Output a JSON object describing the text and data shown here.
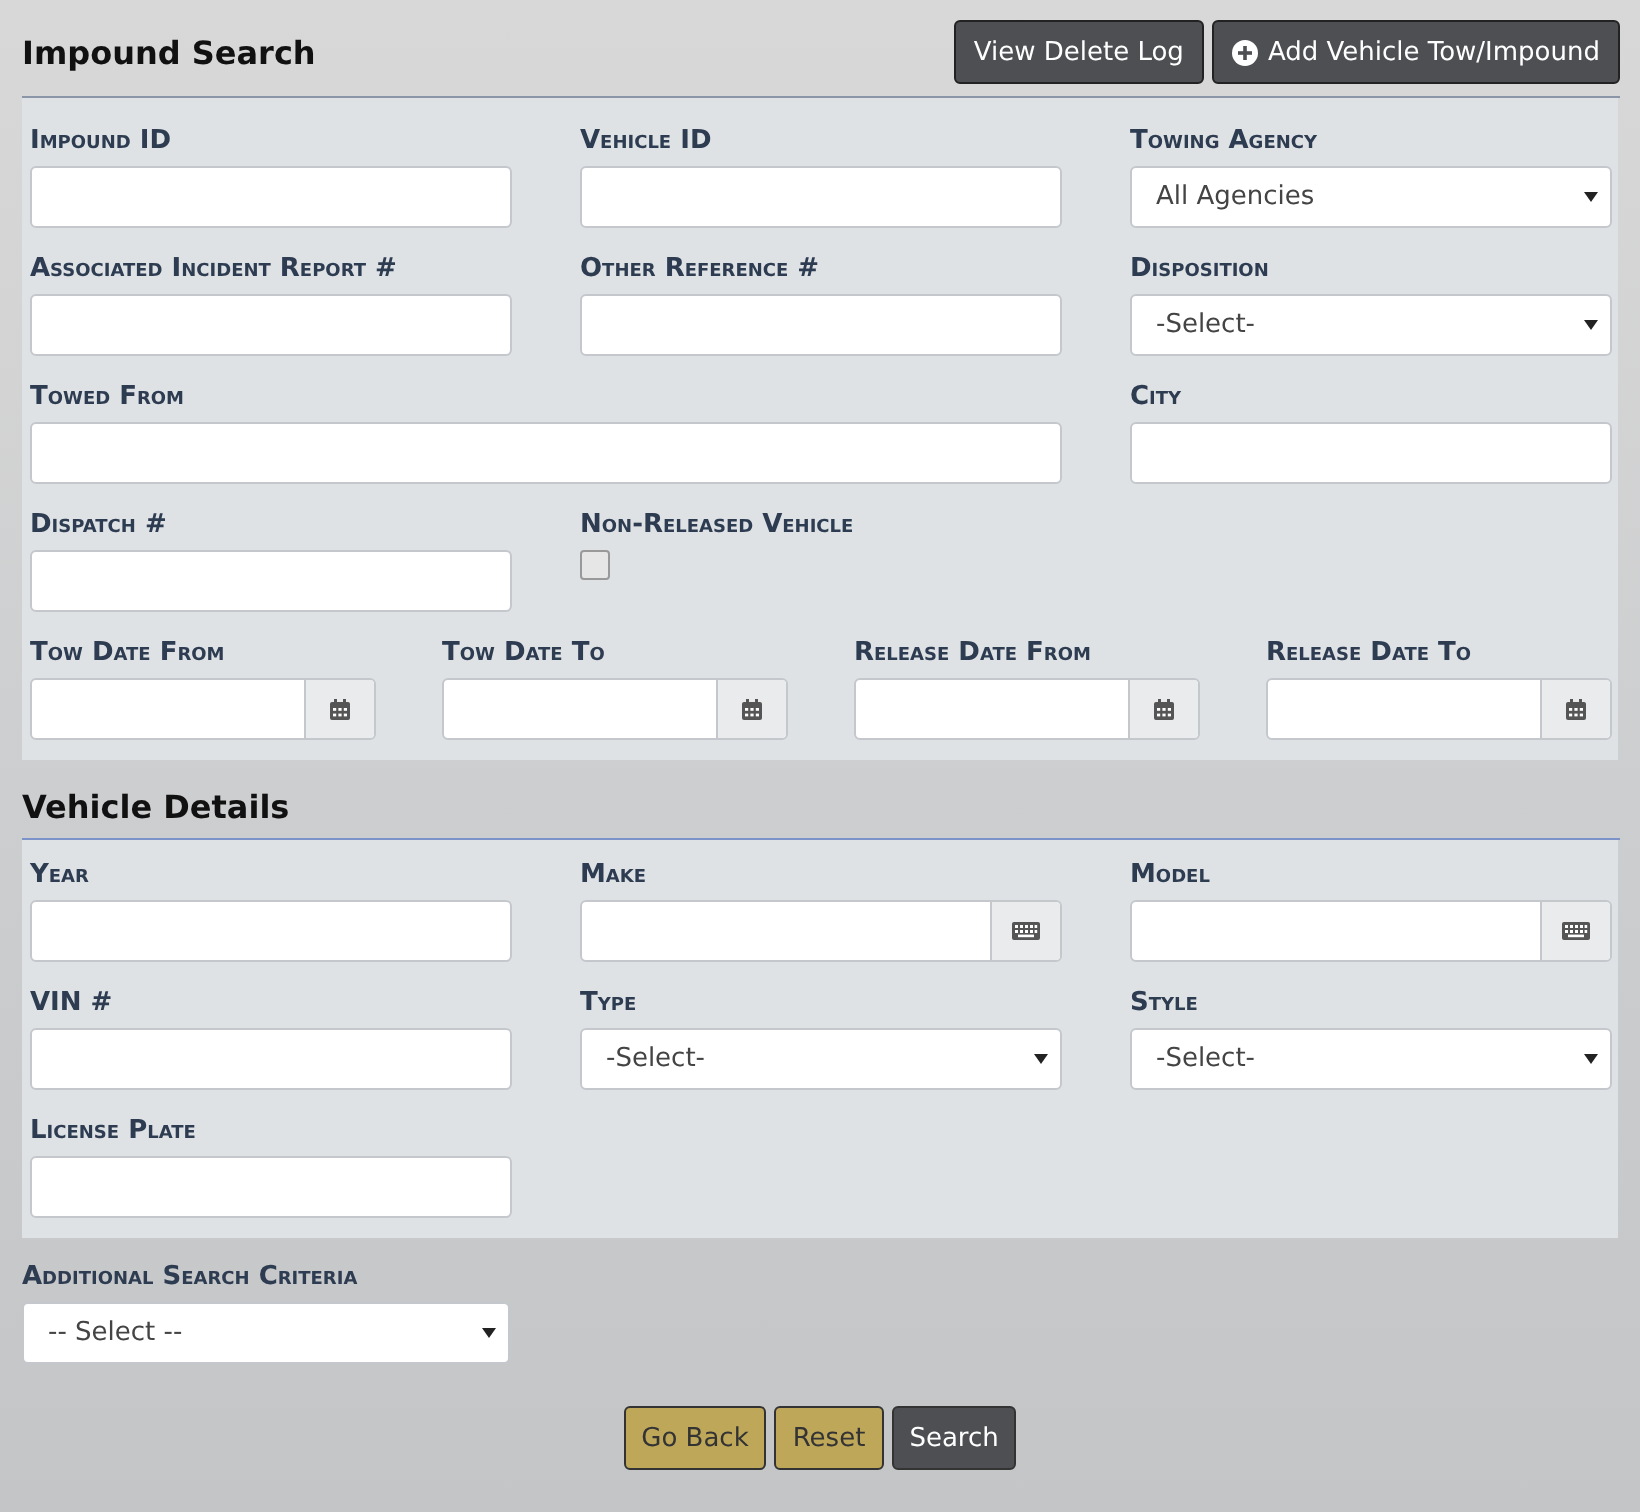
{
  "header": {
    "title": "Impound Search",
    "buttons": [
      {
        "label": "View Delete Log",
        "icon": false
      },
      {
        "label": "Add Vehicle Tow/Impound",
        "icon": true
      }
    ]
  },
  "search_fields": [
    {
      "kind": "text",
      "label": "Impound ID"
    },
    {
      "kind": "text",
      "label": "Vehicle ID"
    },
    {
      "kind": "select",
      "label": "Towing Agency",
      "value": "All Agencies"
    },
    {
      "kind": "text",
      "label": "Associated Incident Report #"
    },
    {
      "kind": "text",
      "label": "Other Reference #"
    },
    {
      "kind": "select",
      "label": "Disposition",
      "value": "-Select-"
    },
    {
      "kind": "text",
      "label": "Towed From",
      "wide": true
    },
    {
      "kind": "text",
      "label": "City"
    },
    {
      "kind": "text",
      "label": "Dispatch #"
    },
    {
      "kind": "checkbox",
      "label": "Non-Released Vehicle",
      "checked": false
    }
  ],
  "date_fields": [
    {
      "label": "Tow Date From"
    },
    {
      "label": "Tow Date To"
    },
    {
      "label": "Release Date From"
    },
    {
      "label": "Release Date To"
    }
  ],
  "vehicle_details": {
    "title": "Vehicle Details",
    "fields": [
      {
        "kind": "text",
        "label": "Year"
      },
      {
        "kind": "picker",
        "label": "Make"
      },
      {
        "kind": "picker",
        "label": "Model"
      },
      {
        "kind": "text",
        "label": "VIN #"
      },
      {
        "kind": "select",
        "label": "Type",
        "value": "-Select-"
      },
      {
        "kind": "select",
        "label": "Style",
        "value": "-Select-"
      },
      {
        "kind": "text",
        "label": "License Plate"
      }
    ]
  },
  "additional": {
    "label": "Additional Search Criteria",
    "value": "-- Select --"
  },
  "footer_buttons": [
    {
      "label": "Go Back",
      "kind": "secondary"
    },
    {
      "label": "Reset",
      "kind": "secondary"
    },
    {
      "label": "Search",
      "kind": "primary"
    }
  ]
}
